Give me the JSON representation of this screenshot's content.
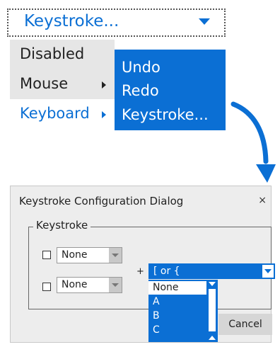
{
  "combo": {
    "selected": "Keystroke..."
  },
  "menu": {
    "items": [
      {
        "label": "Disabled"
      },
      {
        "label": "Mouse"
      },
      {
        "label": "Keyboard"
      }
    ]
  },
  "submenu": {
    "items": [
      {
        "label": "Undo"
      },
      {
        "label": "Redo"
      },
      {
        "label": "Keystroke..."
      }
    ]
  },
  "dialog": {
    "title": "Keystroke Configuration Dialog",
    "close": "×",
    "group_label": "Keystroke",
    "modifier1": "None",
    "modifier2": "None",
    "plus": "+",
    "key_value": "[ or {",
    "key_options": [
      "None",
      "A",
      "B",
      "C"
    ],
    "cancel": "Cancel"
  },
  "colors": {
    "accent": "#0b6fd4",
    "menu_bg": "#e6e6e6",
    "dialog_bg": "#ededed"
  }
}
